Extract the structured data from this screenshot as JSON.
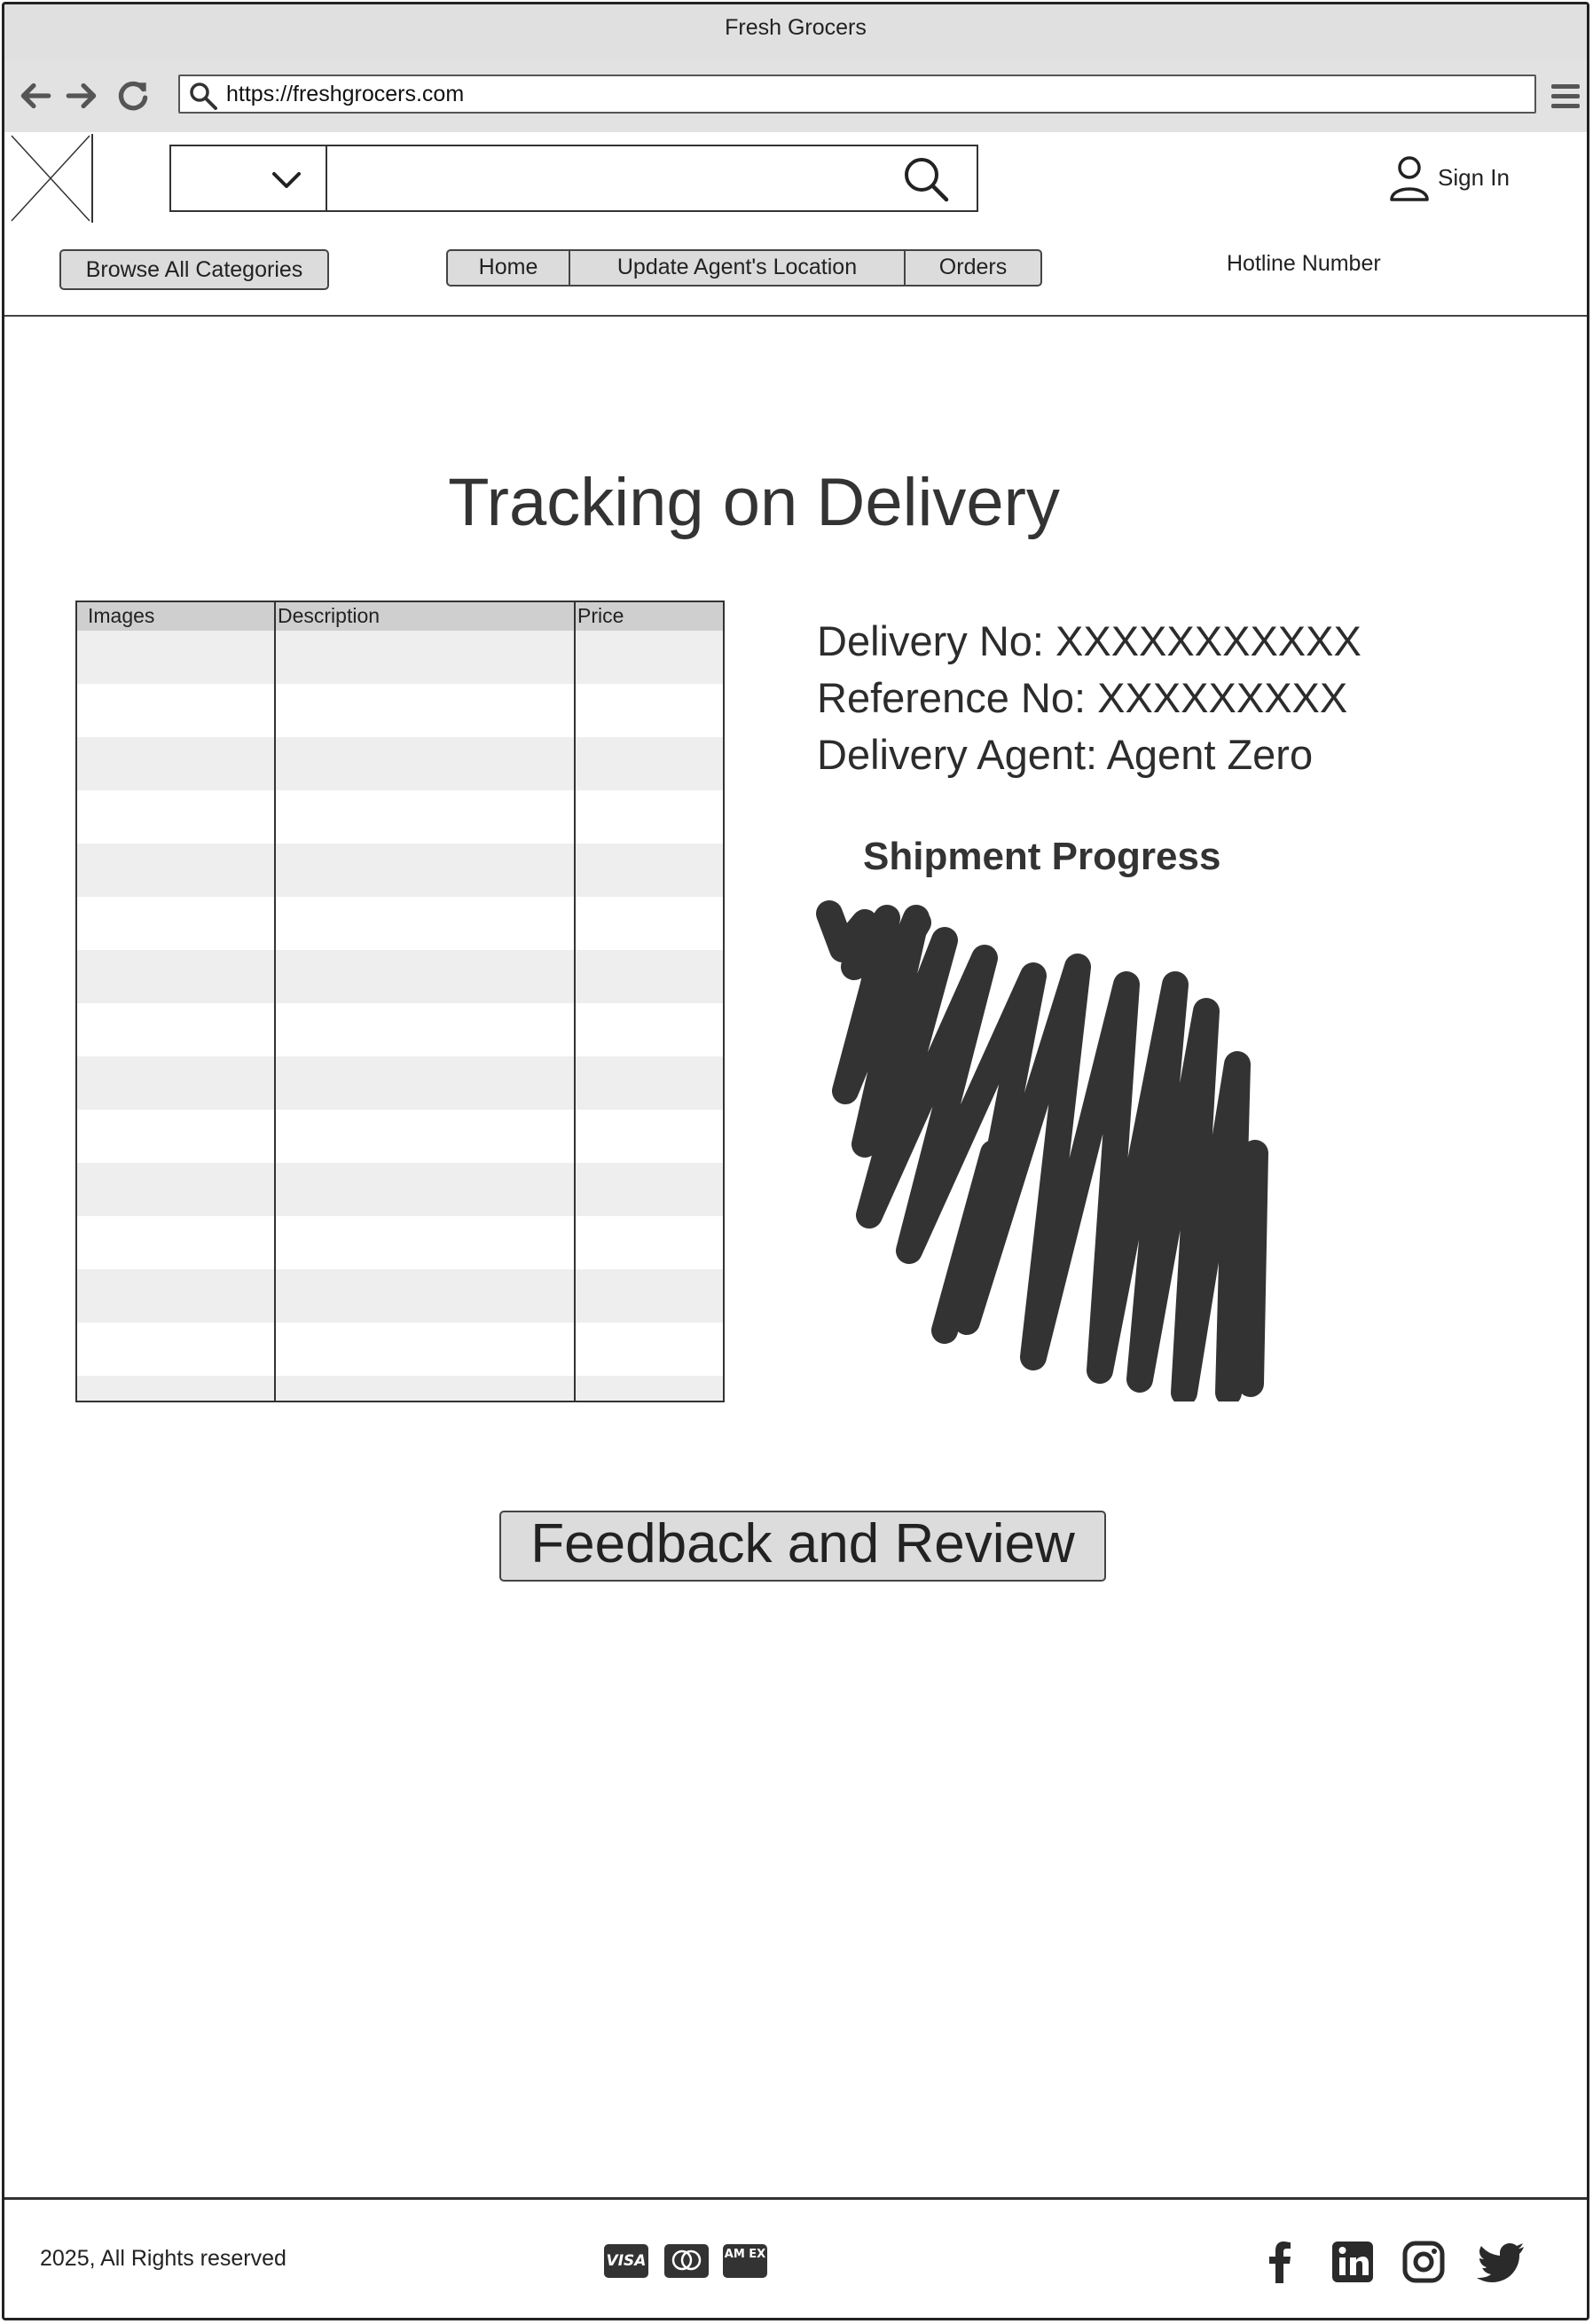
{
  "window": {
    "title": "Fresh Grocers"
  },
  "browser": {
    "url": "https://freshgrocers.com"
  },
  "header": {
    "signin_label": "Sign In"
  },
  "menu": {
    "browse_label": "Browse All Categories",
    "tabs": [
      "Home",
      "Update Agent's Location",
      "Orders"
    ],
    "hotline": "Hotline Number"
  },
  "page": {
    "title": "Tracking on Delivery"
  },
  "table": {
    "columns": [
      "Images",
      "Description",
      "Price"
    ]
  },
  "delivery": {
    "delivery_no": "Delivery No: XXXXXXXXXXX",
    "reference_no": "Reference No: XXXXXXXXX",
    "agent": "Delivery Agent: Agent Zero"
  },
  "shipment": {
    "title": "Shipment Progress"
  },
  "actions": {
    "feedback_label": "Feedback and Review"
  },
  "footer": {
    "copyright": "2025, All Rights reserved",
    "payment_icons": [
      "visa-icon",
      "mastercard-icon",
      "amex-icon"
    ],
    "payment_text": {
      "visa": "VISA",
      "amex": "AM EX"
    },
    "social_icons": [
      "facebook-icon",
      "linkedin-icon",
      "instagram-icon",
      "twitter-icon"
    ]
  }
}
